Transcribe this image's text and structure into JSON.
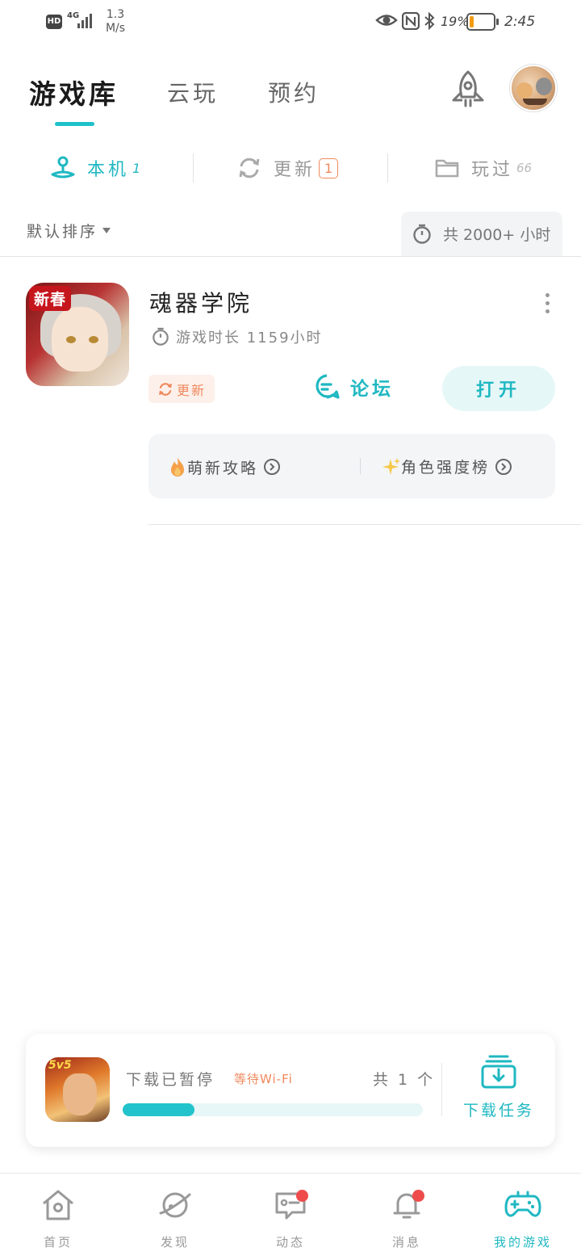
{
  "status_bar": {
    "hd": "HD",
    "network": "4G",
    "speed_value": "1.3",
    "speed_unit": "M/s",
    "battery_text": "19%",
    "battery_level": 0.19,
    "time": "2:45"
  },
  "header": {
    "tabs": [
      {
        "label": "游戏库",
        "active": true
      },
      {
        "label": "云玩",
        "active": false
      },
      {
        "label": "预约",
        "active": false
      }
    ]
  },
  "subtabs": [
    {
      "label": "本机",
      "count": "1",
      "active": true
    },
    {
      "label": "更新",
      "count": "1",
      "active": false
    },
    {
      "label": "玩过",
      "count": "66",
      "active": false
    }
  ],
  "sort": {
    "label": "默认排序"
  },
  "total_time": "共 2000+ 小时",
  "game": {
    "icon_badge": "新春",
    "title": "魂器学院",
    "playtime": "游戏时长 1159小时",
    "update_label": "更新",
    "forum_label": "论坛",
    "open_label": "打开",
    "links": [
      {
        "label": "萌新攻略"
      },
      {
        "label": "角色强度榜"
      }
    ]
  },
  "download": {
    "icon_tag": "5v5",
    "status": "下载已暂停",
    "wait": "等待Wi-Fi",
    "count": "共 1 个",
    "progress": 0.24,
    "task_label": "下载任务"
  },
  "bottom_nav": [
    {
      "label": "首页",
      "active": false,
      "dot": false
    },
    {
      "label": "发现",
      "active": false,
      "dot": false
    },
    {
      "label": "动态",
      "active": false,
      "dot": true
    },
    {
      "label": "消息",
      "active": false,
      "dot": true
    },
    {
      "label": "我的游戏",
      "active": true,
      "dot": false
    }
  ],
  "colors": {
    "accent": "#1fb8c2",
    "update": "#f0885d",
    "badge_dot": "#ef4b4b"
  }
}
